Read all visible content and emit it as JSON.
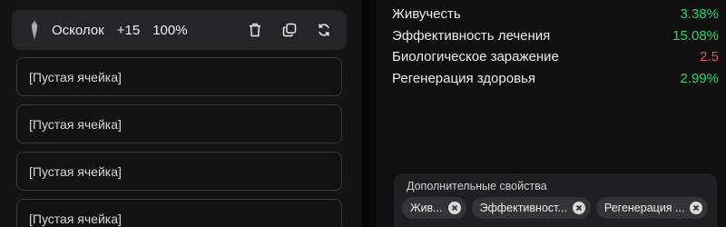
{
  "shard": {
    "name": "Осколок",
    "level": "+15",
    "percent": "100%"
  },
  "slots": [
    "[Пустая ячейка]",
    "[Пустая ячейка]",
    "[Пустая ячейка]",
    "[Пустая ячейка]"
  ],
  "stats": [
    {
      "name": "Живучесть",
      "value": "3.38%",
      "color": "#2bd46b"
    },
    {
      "name": "Эффективность лечения",
      "value": "15.08%",
      "color": "#2bd46b"
    },
    {
      "name": "Биологическое заражение",
      "value": "2.5",
      "color": "#e05555"
    },
    {
      "name": "Регенерация здоровья",
      "value": "2.99%",
      "color": "#2bd46b"
    }
  ],
  "extra": {
    "title": "Дополнительные свойства",
    "chips": [
      "Жив...",
      "Эффективност...",
      "Регенерация ..."
    ]
  }
}
